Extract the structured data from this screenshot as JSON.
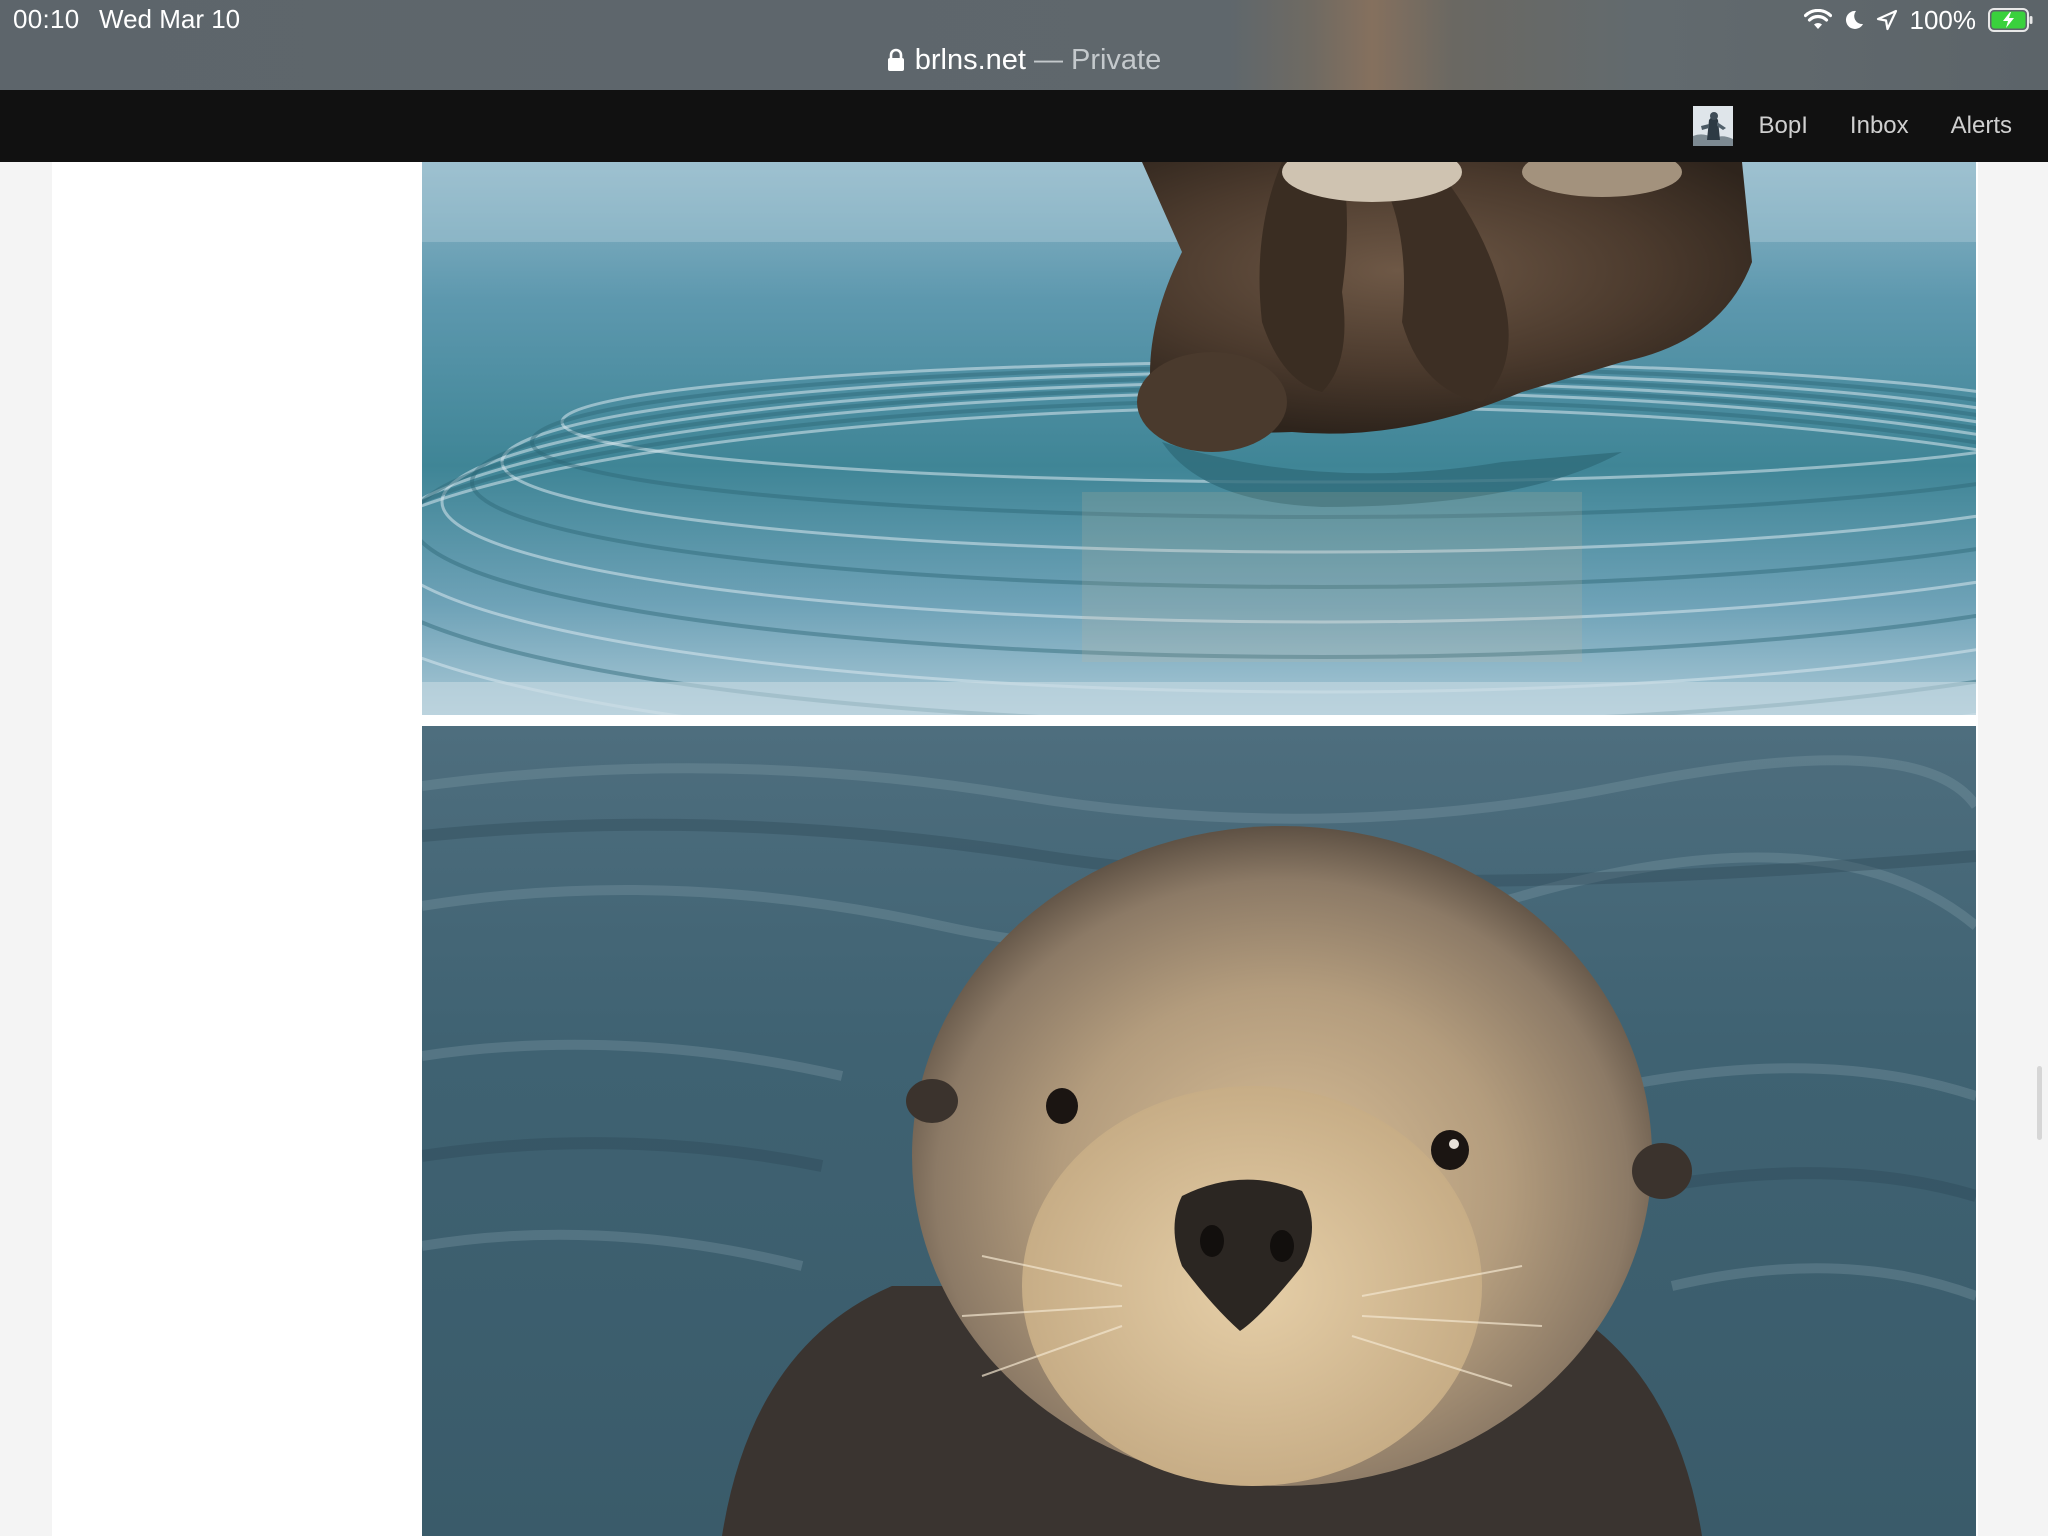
{
  "status_bar": {
    "time": "00:10",
    "date": "Wed Mar 10",
    "battery_percent": "100%",
    "icons": [
      "wifi-icon",
      "moon-icon",
      "location-icon",
      "battery-charging-icon"
    ]
  },
  "address_bar": {
    "domain": "brlns.net",
    "separator": "—",
    "mode": "Private",
    "lock_icon": "lock-icon"
  },
  "navbar": {
    "avatar_icon": "user-avatar",
    "links": [
      {
        "label": "BopI"
      },
      {
        "label": "Inbox"
      },
      {
        "label": "Alerts"
      }
    ]
  },
  "content": {
    "images": [
      {
        "subject": "sea otter floating with paws over face"
      },
      {
        "subject": "sea otter face close-up in water"
      }
    ]
  },
  "colors": {
    "navbar_bg": "#111111",
    "page_bg": "#f4f4f4",
    "content_bg": "#ffffff",
    "nav_link": "#cfcfcf",
    "battery_green": "#3ad13d"
  }
}
